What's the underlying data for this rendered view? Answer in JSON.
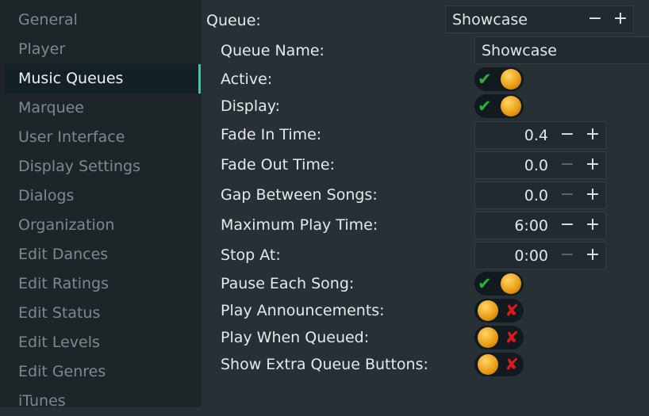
{
  "sidebar": {
    "items": [
      {
        "label": "General"
      },
      {
        "label": "Player"
      },
      {
        "label": "Music Queues",
        "selected": true
      },
      {
        "label": "Marquee"
      },
      {
        "label": "User Interface"
      },
      {
        "label": "Display Settings"
      },
      {
        "label": "Dialogs"
      },
      {
        "label": "Organization"
      },
      {
        "label": "Edit Dances"
      },
      {
        "label": "Edit Ratings"
      },
      {
        "label": "Edit Status"
      },
      {
        "label": "Edit Levels"
      },
      {
        "label": "Edit Genres"
      },
      {
        "label": "iTunes"
      }
    ]
  },
  "queue": {
    "label": "Queue:",
    "selected": "Showcase",
    "minus": "−",
    "plus": "+"
  },
  "settings": {
    "queue_name": {
      "label": "Queue Name:",
      "value": "Showcase"
    },
    "active": {
      "label": "Active:",
      "on": true
    },
    "display": {
      "label": "Display:",
      "on": true
    },
    "fade_in": {
      "label": "Fade In Time:",
      "value": "0.4"
    },
    "fade_out": {
      "label": "Fade Out Time:",
      "value": "0.0"
    },
    "gap": {
      "label": "Gap Between Songs:",
      "value": "0.0"
    },
    "max_play": {
      "label": "Maximum Play Time:",
      "value": "6:00"
    },
    "stop_at": {
      "label": "Stop At:",
      "value": "0:00"
    },
    "pause_each": {
      "label": "Pause Each Song:",
      "on": true
    },
    "play_announcements": {
      "label": "Play Announcements:",
      "on": false
    },
    "play_when_queued": {
      "label": "Play When Queued:",
      "on": false
    },
    "show_extra": {
      "label": "Show Extra Queue Buttons:",
      "on": false
    }
  },
  "icons": {
    "check": "✔",
    "cross": "✘",
    "minus": "−",
    "plus": "+"
  },
  "colors": {
    "accent": "#43c79f",
    "check": "#22b43c",
    "cross": "#e01818",
    "knob": "#e89a12"
  }
}
